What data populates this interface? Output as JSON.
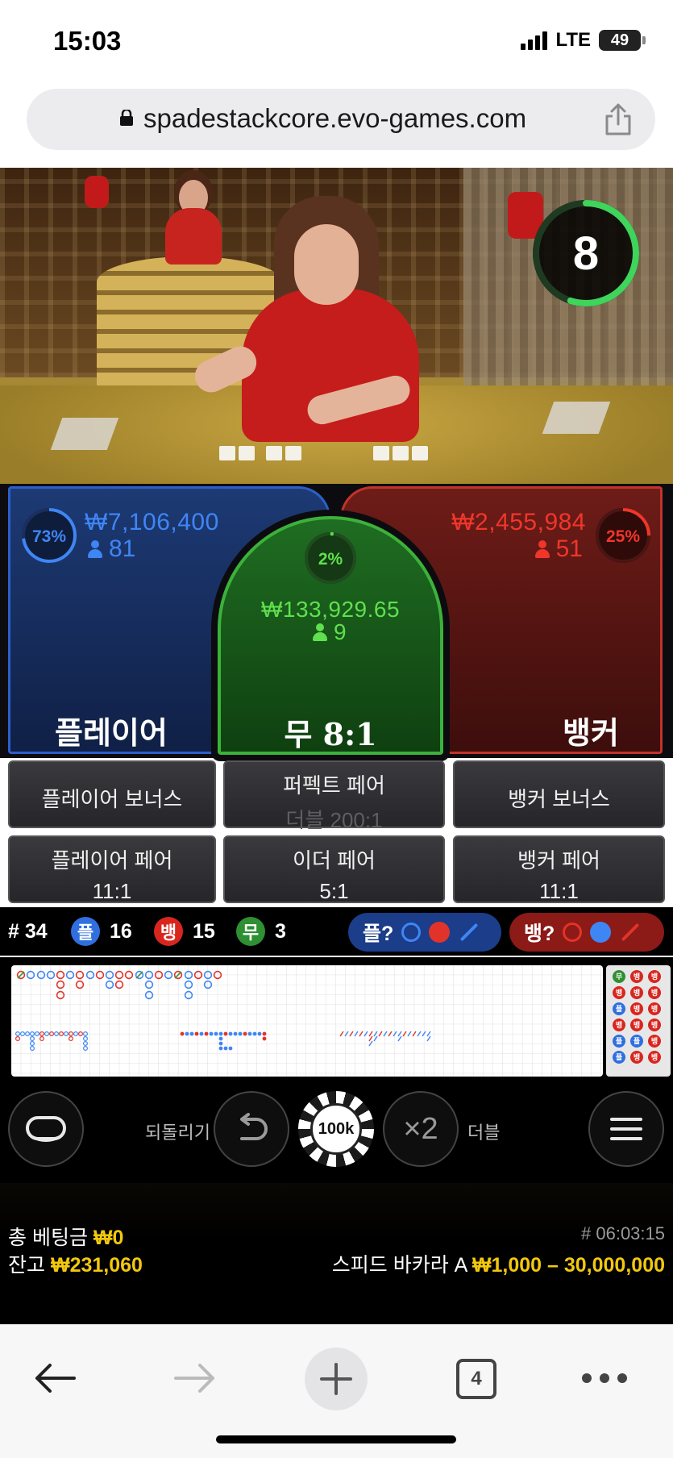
{
  "status_bar": {
    "time": "15:03",
    "network": "LTE",
    "battery": "49"
  },
  "browser": {
    "url": "spadestackcore.evo-games.com",
    "tab_count": "4"
  },
  "timer": {
    "value": "8",
    "progress_fraction": 0.55,
    "color": "#3fd45a"
  },
  "player": {
    "percent": "73%",
    "percent_value": 0.73,
    "amount": "₩7,106,400",
    "players": "81",
    "label": "플레이어",
    "color": "#3f86f5"
  },
  "tie": {
    "percent": "2%",
    "percent_value": 0.02,
    "amount": "₩133,929.65",
    "players": "9",
    "label": "무 8:1",
    "color": "#5fe04e"
  },
  "banker": {
    "percent": "25%",
    "percent_value": 0.25,
    "amount": "₩2,455,984",
    "players": "51",
    "label": "뱅커",
    "color": "#f0362b"
  },
  "side_bets": {
    "player_bonus": "플레이어 보너스",
    "perfect_pair": "퍼펙트 페어",
    "perfect_pair_sub": "더블 200:1",
    "banker_bonus": "뱅커 보너스",
    "player_pair": "플레이어 페어",
    "player_pair_odds": "11:1",
    "either_pair": "이더 페어",
    "either_pair_odds": "5:1",
    "banker_pair": "뱅커 페어",
    "banker_pair_odds": "11:1"
  },
  "stats": {
    "rounds_label": "# 34",
    "player_badge": "플",
    "player_count": "16",
    "banker_badge": "뱅",
    "banker_count": "15",
    "tie_badge": "무",
    "tie_count": "3",
    "player_ask": "플?",
    "banker_ask": "뱅?"
  },
  "controls": {
    "undo_label": "되돌리기",
    "chip_value": "100k",
    "double_icon": "×2",
    "double_label": "더블"
  },
  "footer": {
    "total_bet_label": "총 베팅금",
    "total_bet_value": "₩0",
    "balance_label": "잔고",
    "balance_value": "₩231,060",
    "round_id": "# 06:03:15",
    "table_name": "스피드 바카라 A",
    "limits": "₩1,000 – 30,000,000"
  },
  "colors": {
    "player": "#3f86f5",
    "banker": "#e2332a",
    "tie": "#3fae3c",
    "gold": "#f2c80f"
  }
}
